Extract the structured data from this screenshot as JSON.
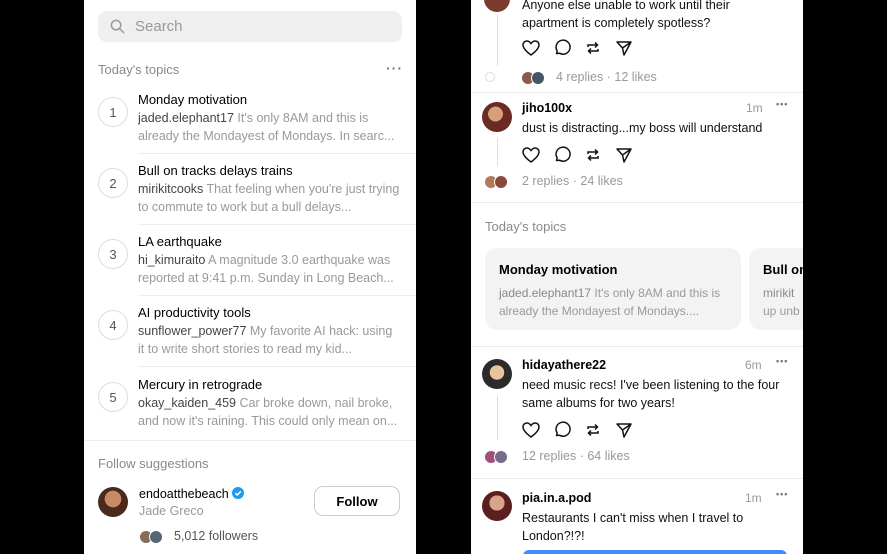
{
  "left": {
    "search_placeholder": "Search",
    "todays_topics_title": "Today's topics",
    "more_glyph": "···",
    "topics": [
      {
        "num": "1",
        "title": "Monday motivation",
        "user": "jaded.elephant17",
        "text": " It's only 8AM and this is already the Mondayest of Mondays. In searc..."
      },
      {
        "num": "2",
        "title": "Bull on tracks delays trains",
        "user": "mirikitcooks",
        "text": " That feeling when you're just trying to commute to work but a bull delays..."
      },
      {
        "num": "3",
        "title": "LA earthquake",
        "user": "hi_kimuraito",
        "text": " A magnitude 3.0 earthquake was reported at 9:41 p.m. Sunday in Long Beach..."
      },
      {
        "num": "4",
        "title": "AI productivity tools",
        "user": "sunflower_power77",
        "text": " My favorite AI hack: using it to write short stories to read my kid..."
      },
      {
        "num": "5",
        "title": "Mercury in retrograde",
        "user": "okay_kaiden_459",
        "text": " Car broke down, nail broke, and now it's raining. This could only mean on..."
      }
    ],
    "follow_suggestions_title": "Follow suggestions",
    "suggestion": {
      "username": "endoatthebeach",
      "name": "Jade Greco",
      "followers": "5,012 followers",
      "follow_label": "Follow"
    }
  },
  "right": {
    "post0": {
      "text": "Anyone else unable to work until their apartment is completely spotless?",
      "replies": "4 replies",
      "likes": "12 likes"
    },
    "post1": {
      "username": "jiho100x",
      "time": "1m",
      "text": "dust is distracting...my boss will understand",
      "replies": "2 replies",
      "likes": "24 likes"
    },
    "todays_topics_title": "Today's topics",
    "cards": [
      {
        "title": "Monday motivation",
        "user": "jaded.elephant17",
        "text": " It's only 8AM and this is already the Mondayest of Mondays...."
      },
      {
        "title": "Bull on",
        "user": "mirikit",
        "text": "up unb"
      }
    ],
    "post2": {
      "username": "hidayathere22",
      "time": "6m",
      "text": "need music recs! I've been listening to the four same albums for two years!",
      "replies": "12 replies",
      "likes": "64 likes"
    },
    "post3": {
      "username": "pia.in.a.pod",
      "time": "1m",
      "text": "Restaurants I can't miss when I travel to London?!?!"
    },
    "sep": "·",
    "more_glyph": "•••"
  },
  "colors": {
    "verified": "#1d9bf0",
    "accent_blue": "#3d8bfd",
    "muted": "#999999"
  }
}
